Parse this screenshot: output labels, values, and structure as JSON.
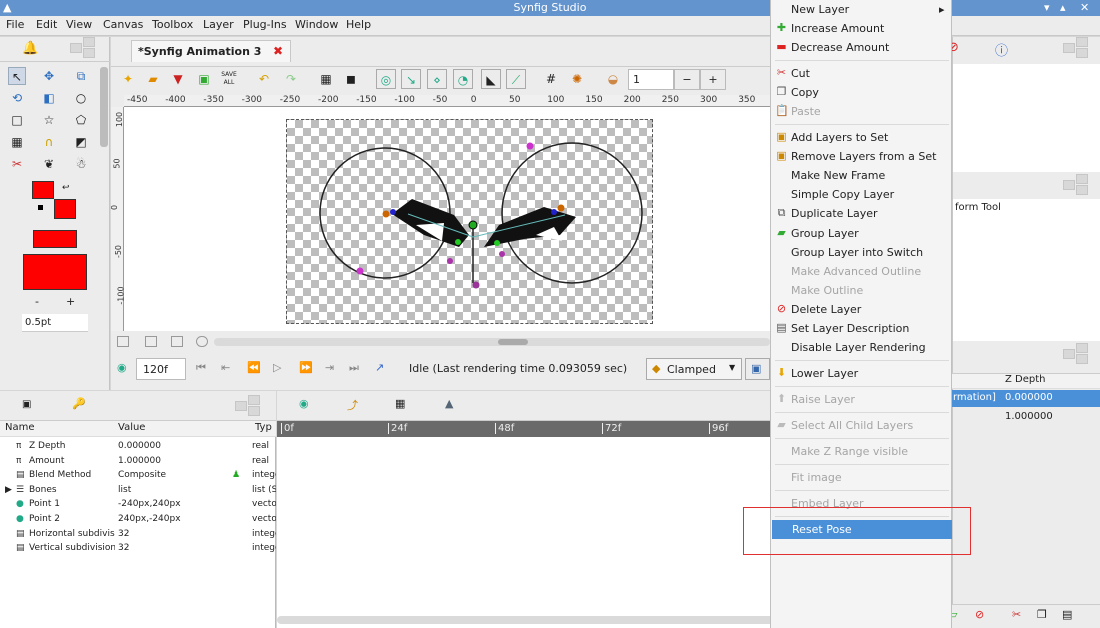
{
  "window": {
    "title": "Synfig Studio"
  },
  "menu": [
    "File",
    "Edit",
    "View",
    "Canvas",
    "Toolbox",
    "Layer",
    "Plug-Ins",
    "Window",
    "Help"
  ],
  "document": {
    "tab_title": "*Synfig Animation 3"
  },
  "toolbar": {
    "save_all_label": "SAVE ALL",
    "zoom_value": "1",
    "minus": "−",
    "plus": "+"
  },
  "rulers": {
    "h_ticks": [
      "-450",
      "-400",
      "-350",
      "-300",
      "-250",
      "-200",
      "-150",
      "-100",
      "-50",
      "0",
      "50",
      "100",
      "150",
      "200",
      "250",
      "300",
      "350"
    ],
    "v_ticks": [
      "100",
      "50",
      "0",
      "-50",
      "-100"
    ]
  },
  "toolbox": {
    "width_minus": "-",
    "width_plus": "+",
    "width_value": "0.5pt"
  },
  "playback": {
    "end_frame": "120f",
    "status": "Idle (Last rendering time 0.093059 sec)",
    "interpolation": "Clamped"
  },
  "params": {
    "headers": {
      "name": "Name",
      "value": "Value",
      "type": "Typ"
    },
    "rows": [
      {
        "icon": "π",
        "name": "Z Depth",
        "value": "0.000000",
        "type": "real"
      },
      {
        "icon": "π",
        "name": "Amount",
        "value": "1.000000",
        "type": "real"
      },
      {
        "icon": "▤",
        "name": "Blend Method",
        "value": "Composite",
        "type": "intege"
      },
      {
        "icon": "☰",
        "name": "Bones",
        "value": "list",
        "type": "list (S"
      },
      {
        "icon": "●",
        "name": "Point 1",
        "value": "-240px,240px",
        "type": "vecto"
      },
      {
        "icon": "●",
        "name": "Point 2",
        "value": "240px,-240px",
        "type": "vecto"
      },
      {
        "icon": "▤",
        "name": "Horizontal subdivisi",
        "value": "32",
        "type": "intege"
      },
      {
        "icon": "▤",
        "name": "Vertical subdivisions",
        "value": "32",
        "type": "intege"
      }
    ]
  },
  "timeline": {
    "ticks": [
      "0f",
      "24f",
      "48f",
      "72f",
      "96f"
    ]
  },
  "right_panel": {
    "tool_text": "form Tool",
    "zdepth_header": "Z Depth",
    "rows": [
      {
        "name": "rmation]",
        "value": "0.000000"
      },
      {
        "name": "",
        "value": "1.000000"
      }
    ]
  },
  "context_menu": {
    "items": [
      {
        "label": "New Layer",
        "icon": "",
        "disabled": false,
        "submenu": true
      },
      {
        "label": "Increase Amount",
        "icon": "✚",
        "disabled": false
      },
      {
        "label": "Decrease Amount",
        "icon": "▬",
        "disabled": false
      },
      {
        "label": "Cut",
        "icon": "✂",
        "disabled": false
      },
      {
        "label": "Copy",
        "icon": "❐",
        "disabled": false
      },
      {
        "label": "Paste",
        "icon": "📋",
        "disabled": true
      },
      {
        "label": "Add Layers to Set",
        "icon": "▣",
        "disabled": false
      },
      {
        "label": "Remove Layers from a Set",
        "icon": "▣",
        "disabled": false
      },
      {
        "label": "Make New Frame",
        "icon": "",
        "disabled": false
      },
      {
        "label": "Simple Copy Layer",
        "icon": "",
        "disabled": false
      },
      {
        "label": "Duplicate Layer",
        "icon": "⧉",
        "disabled": false
      },
      {
        "label": "Group Layer",
        "icon": "▰",
        "disabled": false
      },
      {
        "label": "Group Layer into Switch",
        "icon": "",
        "disabled": false
      },
      {
        "label": "Make Advanced Outline",
        "icon": "",
        "disabled": true
      },
      {
        "label": "Make Outline",
        "icon": "",
        "disabled": true
      },
      {
        "label": "Delete Layer",
        "icon": "⊘",
        "disabled": false
      },
      {
        "label": "Set Layer Description",
        "icon": "▤",
        "disabled": false
      },
      {
        "label": "Disable Layer Rendering",
        "icon": "",
        "disabled": false
      },
      {
        "label": "Lower Layer",
        "icon": "⬇",
        "disabled": false
      },
      {
        "label": "Raise Layer",
        "icon": "⬆",
        "disabled": true
      },
      {
        "label": "Select All Child Layers",
        "icon": "▰",
        "disabled": true
      },
      {
        "label": "Make Z Range visible",
        "icon": "",
        "disabled": true
      },
      {
        "label": "Fit image",
        "icon": "",
        "disabled": true
      },
      {
        "label": "Embed Layer",
        "icon": "",
        "disabled": true
      },
      {
        "label": "Reset Pose",
        "icon": "",
        "disabled": false,
        "selected": true
      }
    ]
  }
}
